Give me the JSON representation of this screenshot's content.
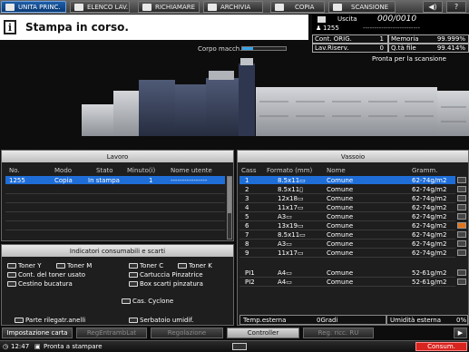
{
  "tabs": [
    {
      "label": "UNITA PRINC.",
      "icon": "home-icon"
    },
    {
      "label": "ELENCO LAV.",
      "icon": "job-list-icon"
    },
    {
      "label": "RICHIAMARE",
      "icon": "printer-icon"
    },
    {
      "label": "ARCHIVIA",
      "icon": "archive-icon"
    },
    {
      "label": "COPIA",
      "icon": "copy-icon"
    },
    {
      "label": "SCANSIONE",
      "icon": "scan-icon"
    }
  ],
  "header_buttons": {
    "volume": "◀)",
    "help": "?"
  },
  "banner": {
    "message": "Stampa in corso.",
    "icon": "info-icon"
  },
  "counters": {
    "uscita_label": "Uscita",
    "uscita_value": "000/0010",
    "user_count": "1255",
    "user_dashes": "-------------------------",
    "cont_orig_label": "Cont. ORIG.",
    "cont_orig_value": "1",
    "memoria_label": "Memoria",
    "memoria_value": "99.999%",
    "lav_riserv_label": "Lav.Riserv.",
    "lav_riserv_value": "0",
    "qta_file_label": "Q.tà file",
    "qta_file_value": "99.414%"
  },
  "corpo_macch": {
    "label": "Corpo macch.",
    "progress": 0.25
  },
  "ready_text": "Pronta per la scansione",
  "lavoro": {
    "title": "Lavoro",
    "columns": [
      "No.",
      "Modo",
      "Stato",
      "Minuto(i)",
      "Nome utente"
    ],
    "rows": [
      {
        "no": "1255",
        "modo": "Copia",
        "stato": "In stampa",
        "minuti": "1",
        "utente": "----------------"
      }
    ]
  },
  "indicatori": {
    "title": "Indicatori consumabili e scarti",
    "items": [
      {
        "label": "Toner Y",
        "icon": "toner-icon"
      },
      {
        "label": "Toner M",
        "icon": "toner-icon"
      },
      {
        "label": "Toner C",
        "icon": "toner-icon"
      },
      {
        "label": "Toner K",
        "icon": "toner-icon"
      },
      {
        "label": "Cont. del toner usato",
        "icon": "waste-toner-icon"
      },
      {
        "label": "Cartuccia Pinzatrice",
        "icon": "staple-icon"
      },
      {
        "label": "Cestino bucatura",
        "icon": "punch-icon"
      },
      {
        "label": "Box scarti pinzatura",
        "icon": "staple-waste-icon"
      },
      {
        "label": "Cas. Cyclone",
        "icon": "cyclone-icon"
      },
      {
        "label": "Parte rilegatr.anelli",
        "icon": "ring-binder-icon"
      },
      {
        "label": "Serbatoio umidif.",
        "icon": "tank-icon"
      }
    ]
  },
  "vassoio": {
    "title": "Vassoio",
    "columns": [
      "Cass",
      "Formato (mm)",
      "Nome",
      "Gramm."
    ],
    "rows": [
      {
        "cass": "1",
        "formato": "8.5x11▭",
        "nome": "Comune",
        "gramm": "62-74g/m2",
        "selected": true
      },
      {
        "cass": "2",
        "formato": "8.5x11▯",
        "nome": "Comune",
        "gramm": "62-74g/m2"
      },
      {
        "cass": "3",
        "formato": "12x18▭",
        "nome": "Comune",
        "gramm": "62-74g/m2"
      },
      {
        "cass": "4",
        "formato": "11x17▭",
        "nome": "Comune",
        "gramm": "62-74g/m2"
      },
      {
        "cass": "5",
        "formato": "A3▭",
        "nome": "Comune",
        "gramm": "62-74g/m2"
      },
      {
        "cass": "6",
        "formato": "13x19▭",
        "nome": "Comune",
        "gramm": "62-74g/m2",
        "warning": true
      },
      {
        "cass": "7",
        "formato": "8.5x11▭",
        "nome": "Comune",
        "gramm": "62-74g/m2"
      },
      {
        "cass": "8",
        "formato": "A3▭",
        "nome": "Comune",
        "gramm": "62-74g/m2"
      },
      {
        "cass": "9",
        "formato": "11x17▭",
        "nome": "Comune",
        "gramm": "62-74g/m2"
      },
      {
        "cass": "PI1",
        "formato": "A4▭",
        "nome": "Comune",
        "gramm": "52-61g/m2"
      },
      {
        "cass": "PI2",
        "formato": "A4▭",
        "nome": "Comune",
        "gramm": "52-61g/m2"
      }
    ],
    "temp_label": "Temp.esterna",
    "temp_value": "0Gradi",
    "umid_label": "Umidità esterna",
    "umid_value": "0%"
  },
  "bottom_tabs": [
    "Impostazione carta",
    "RegEntrambLat",
    "Regolazione",
    "Controller",
    "Reg. ricc. RU"
  ],
  "status": {
    "time": "12:47",
    "message": "Pronta a stampare",
    "consum": "Consum."
  },
  "colors": {
    "accent": "#1f6ed8",
    "consum_bg": "#d8241f"
  }
}
